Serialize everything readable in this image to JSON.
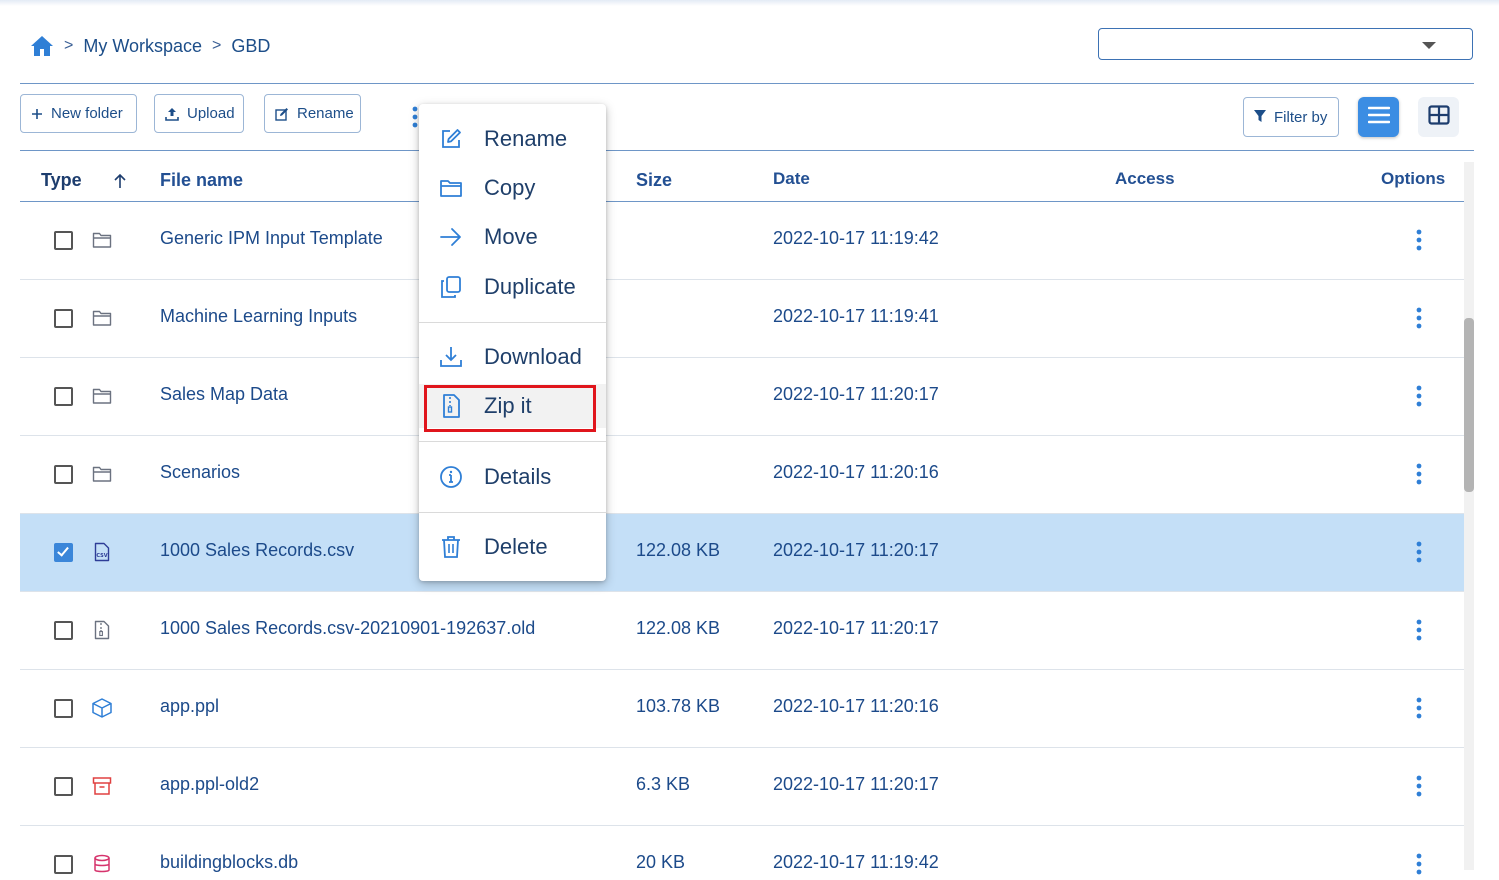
{
  "breadcrumb": {
    "items": [
      "My Workspace",
      "GBD"
    ],
    "separator": ">"
  },
  "workspace_select": {
    "value": ""
  },
  "toolbar": {
    "new_folder": "New folder",
    "upload": "Upload",
    "rename": "Rename",
    "filter": "Filter by"
  },
  "table": {
    "headers": {
      "type": "Type",
      "file_name": "File name",
      "size": "Size",
      "date": "Date",
      "access": "Access",
      "options": "Options"
    },
    "rows": [
      {
        "icon": "folder-icon",
        "name": "Generic IPM Input Template",
        "size": "",
        "date": "2022-10-17 11:19:42",
        "selected": false
      },
      {
        "icon": "folder-icon",
        "name": "Machine Learning Inputs",
        "size": "",
        "date": "2022-10-17 11:19:41",
        "selected": false
      },
      {
        "icon": "folder-icon",
        "name": "Sales Map Data",
        "size": "",
        "date": "2022-10-17 11:20:17",
        "selected": false
      },
      {
        "icon": "folder-icon",
        "name": "Scenarios",
        "size": "",
        "date": "2022-10-17 11:20:16",
        "selected": false
      },
      {
        "icon": "csv-file-icon",
        "name": "1000 Sales Records.csv",
        "size": "122.08 KB",
        "date": "2022-10-17 11:20:17",
        "selected": true
      },
      {
        "icon": "archive-file-icon",
        "name": "1000 Sales Records.csv-20210901-192637.old",
        "size": "122.08 KB",
        "date": "2022-10-17 11:20:17",
        "selected": false
      },
      {
        "icon": "cube-icon",
        "name": "app.ppl",
        "size": "103.78 KB",
        "date": "2022-10-17 11:20:16",
        "selected": false
      },
      {
        "icon": "archive-box-icon",
        "name": "app.ppl-old2",
        "size": "6.3 KB",
        "date": "2022-10-17 11:20:17",
        "selected": false
      },
      {
        "icon": "database-icon",
        "name": "buildingblocks.db",
        "size": "20 KB",
        "date": "2022-10-17 11:19:42",
        "selected": false
      }
    ]
  },
  "context_menu": {
    "items": [
      {
        "label": "Rename",
        "icon": "edit-icon"
      },
      {
        "label": "Copy",
        "icon": "folder-icon"
      },
      {
        "label": "Move",
        "icon": "arrow-right-icon"
      },
      {
        "label": "Duplicate",
        "icon": "duplicate-icon"
      },
      {
        "label": "Download",
        "icon": "download-icon"
      },
      {
        "label": "Zip it",
        "icon": "zip-file-icon"
      },
      {
        "label": "Details",
        "icon": "info-icon"
      },
      {
        "label": "Delete",
        "icon": "trash-icon"
      }
    ],
    "highlighted": "Zip it"
  },
  "colors": {
    "accent": "#3b8de3",
    "selected_row": "#c4dff7",
    "text": "#1c4a8a",
    "highlight_box": "#e0151c"
  }
}
